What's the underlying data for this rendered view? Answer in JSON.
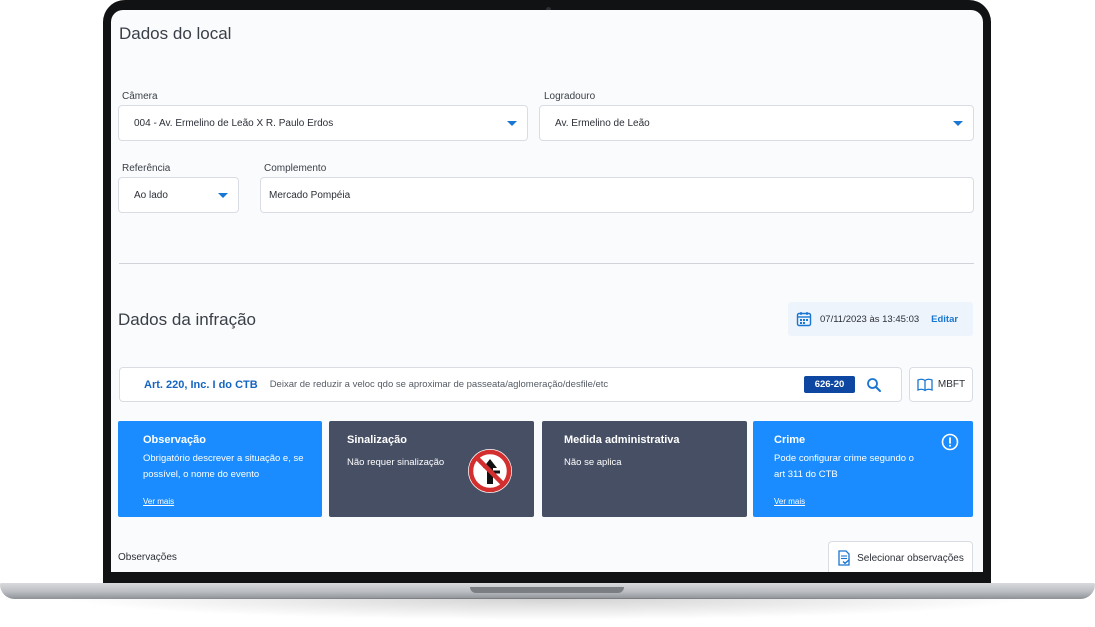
{
  "colors": {
    "accent": "#1976d2",
    "card_blue": "#1a8cff",
    "card_dark": "#474f64",
    "badge": "#0d47a1"
  },
  "location": {
    "title": "Dados do local",
    "camera": {
      "label": "Câmera",
      "value": "004 - Av. Ermelino de Leão  X  R. Paulo Erdos"
    },
    "street": {
      "label": "Logradouro",
      "value": "Av. Ermelino de Leão"
    },
    "reference": {
      "label": "Referência",
      "value": "Ao lado"
    },
    "complement": {
      "label": "Complemento",
      "value": "Mercado Pompéia"
    }
  },
  "infraction": {
    "title": "Dados da infração",
    "datetime": "07/11/2023 às 13:45:03",
    "edit_label": "Editar",
    "article_code": "Art. 220, Inc. I do CTB",
    "article_description": "Deixar de reduzir a veloc qdo se aproximar de passeata/aglomeração/desfile/etc",
    "article_badge": "626-20",
    "mbft_label": "MBFT"
  },
  "cards": {
    "observation": {
      "title": "Observação",
      "text": "Obrigatório descrever a situação e, se possível, o nome do evento",
      "link": "Ver mais"
    },
    "signage": {
      "title": "Sinalização",
      "text": "Não requer sinalização",
      "icon": "no-right-turn-sign-icon"
    },
    "admin_measure": {
      "title": "Medida administrativa",
      "text": "Não se aplica"
    },
    "crime": {
      "title": "Crime",
      "text": "Pode configurar crime segundo o art 311 do CTB",
      "link": "Ver mais",
      "icon": "alert-circle-icon"
    }
  },
  "observations": {
    "label": "Observações",
    "select_button": "Selecionar observações"
  }
}
